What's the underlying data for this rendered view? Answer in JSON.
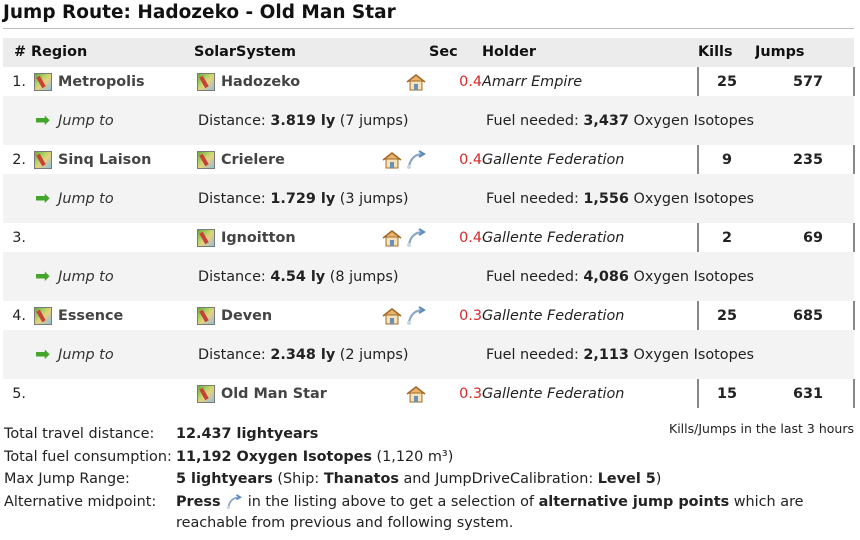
{
  "title": "Jump Route: Hadozeko - Old Man Star",
  "columns": {
    "num": "#",
    "region": "Region",
    "system": "SolarSystem",
    "sec": "Sec",
    "holder": "Holder",
    "kills": "Kills",
    "jumps": "Jumps"
  },
  "systems": [
    {
      "num": "1.",
      "region": "Metropolis",
      "system": "Hadozeko",
      "sec": "0.4",
      "holder": "Amarr Empire",
      "kills": "25",
      "jumps": "577"
    },
    {
      "num": "2.",
      "region": "Sinq Laison",
      "system": "Crielere",
      "sec": "0.4",
      "holder": "Gallente Federation",
      "kills": "9",
      "jumps": "235"
    },
    {
      "num": "3.",
      "region": "",
      "system": "Ignoitton",
      "sec": "0.4",
      "holder": "Gallente Federation",
      "kills": "2",
      "jumps": "69"
    },
    {
      "num": "4.",
      "region": "Essence",
      "system": "Deven",
      "sec": "0.3",
      "holder": "Gallente Federation",
      "kills": "25",
      "jumps": "685"
    },
    {
      "num": "5.",
      "region": "",
      "system": "Old Man Star",
      "sec": "0.3",
      "holder": "Gallente Federation",
      "kills": "15",
      "jumps": "631"
    }
  ],
  "jumps": [
    {
      "label": "Jump to",
      "distance_label": "Distance:",
      "distance": "3.819 ly",
      "jumps_text": "(7 jumps)",
      "fuel_label": "Fuel needed:",
      "fuel": "3,437",
      "fuel_type": "Oxygen Isotopes"
    },
    {
      "label": "Jump to",
      "distance_label": "Distance:",
      "distance": "1.729 ly",
      "jumps_text": "(3 jumps)",
      "fuel_label": "Fuel needed:",
      "fuel": "1,556",
      "fuel_type": "Oxygen Isotopes"
    },
    {
      "label": "Jump to",
      "distance_label": "Distance:",
      "distance": "4.54 ly",
      "jumps_text": "(8 jumps)",
      "fuel_label": "Fuel needed:",
      "fuel": "4,086",
      "fuel_type": "Oxygen Isotopes"
    },
    {
      "label": "Jump to",
      "distance_label": "Distance:",
      "distance": "2.348 ly",
      "jumps_text": "(2 jumps)",
      "fuel_label": "Fuel needed:",
      "fuel": "2,113",
      "fuel_type": "Oxygen Isotopes"
    }
  ],
  "note": "Kills/Jumps in the last 3 hours",
  "summary": {
    "travel_label": "Total travel distance:",
    "travel_value": "12.437 lightyears",
    "fuel_label": "Total fuel consumption:",
    "fuel_value": "11,192 Oxygen Isotopes",
    "fuel_volume": "(1,120 m³)",
    "range_label": "Max Jump Range:",
    "range_value": "5 lightyears",
    "ship_prefix": "(Ship:",
    "ship": "Thanatos",
    "skill_prefix": "and JumpDriveCalibration:",
    "skill": "Level 5",
    "skill_suffix": ")",
    "alt_label": "Alternative midpoint:",
    "alt_press": "Press",
    "alt_middle": "in the listing above to get a selection of",
    "alt_bold": "alternative jump points",
    "alt_end": "which are reachable from previous and following system."
  },
  "colors": {
    "sec_low": "#d42a2a",
    "arrow": "#43a62a",
    "header_bg": "#ececec",
    "jump_row_bg": "#f3f3f3"
  }
}
